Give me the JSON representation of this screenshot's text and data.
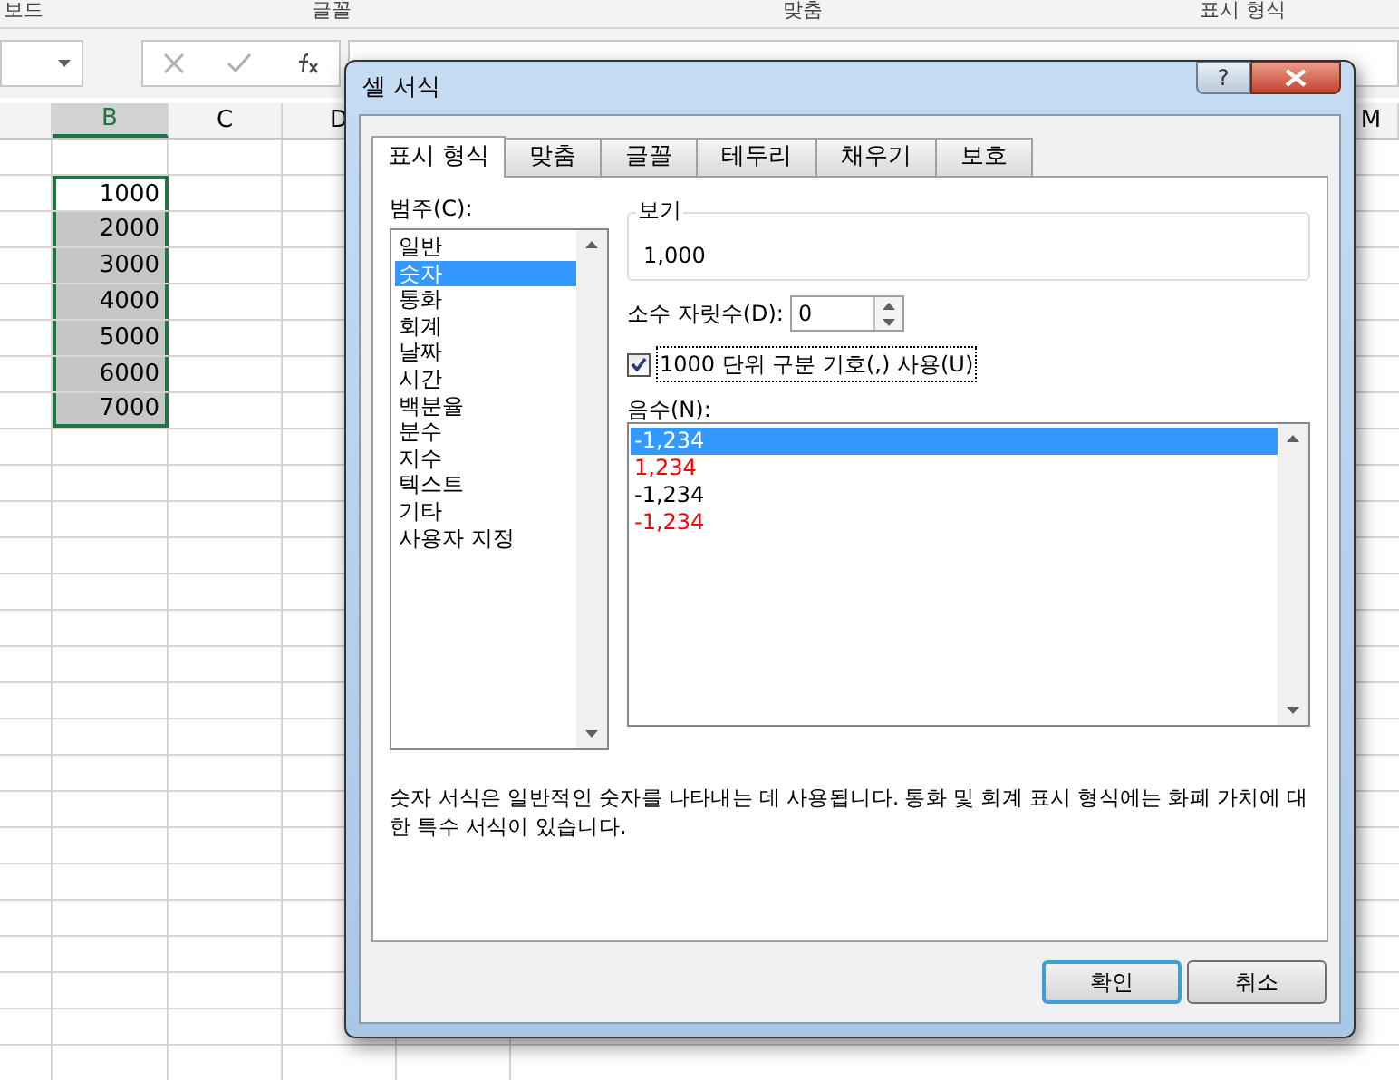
{
  "ribbon_groups": [
    "보드",
    "글꼴",
    "맞춤",
    "표시 형식"
  ],
  "columns": [
    {
      "label": "B",
      "selected": true
    },
    {
      "label": "C",
      "selected": false
    },
    {
      "label": "D",
      "selected": false
    },
    {
      "label": "M",
      "selected": false
    }
  ],
  "cells": [
    {
      "value": "1000",
      "active": true
    },
    {
      "value": "2000",
      "active": false
    },
    {
      "value": "3000",
      "active": false
    },
    {
      "value": "4000",
      "active": false
    },
    {
      "value": "5000",
      "active": false
    },
    {
      "value": "6000",
      "active": false
    },
    {
      "value": "7000",
      "active": false
    }
  ],
  "dialog": {
    "title": "셀 서식",
    "help_button": "?",
    "tabs": [
      {
        "label": "표시 형식",
        "selected": true
      },
      {
        "label": "맞춤",
        "selected": false
      },
      {
        "label": "글꼴",
        "selected": false
      },
      {
        "label": "테두리",
        "selected": false
      },
      {
        "label": "채우기",
        "selected": false
      },
      {
        "label": "보호",
        "selected": false
      }
    ],
    "category_label": "범주(C):",
    "categories": [
      {
        "label": "일반",
        "selected": false
      },
      {
        "label": "숫자",
        "selected": true
      },
      {
        "label": "통화",
        "selected": false
      },
      {
        "label": "회계",
        "selected": false
      },
      {
        "label": "날짜",
        "selected": false
      },
      {
        "label": "시간",
        "selected": false
      },
      {
        "label": "백분율",
        "selected": false
      },
      {
        "label": "분수",
        "selected": false
      },
      {
        "label": "지수",
        "selected": false
      },
      {
        "label": "텍스트",
        "selected": false
      },
      {
        "label": "기타",
        "selected": false
      },
      {
        "label": "사용자 지정",
        "selected": false
      }
    ],
    "preview": {
      "label": "보기",
      "value": "1,000"
    },
    "decimal_places": {
      "label": "소수 자릿수(D):",
      "value": "0"
    },
    "thousands_separator": {
      "label": "1000 단위 구분 기호(,) 사용(U)",
      "checked": true
    },
    "negative_numbers": {
      "label": "음수(N):",
      "options": [
        {
          "text": "-1,234",
          "selected": true
        },
        {
          "text": "1,234",
          "color": "#ff0000",
          "selected": false
        },
        {
          "text": "-1,234",
          "color": "#000000",
          "selected": false
        },
        {
          "text": "-1,234",
          "color": "#ff0000",
          "selected": false
        }
      ]
    },
    "description": "숫자 서식은 일반적인 숫자를 나타내는 데 사용됩니다. 통화 및 회계 표시 형식에는 화폐 가치에 대한 특수 서식이 있습니다.",
    "buttons": [
      {
        "label": "확인",
        "default": true
      },
      {
        "label": "취소",
        "default": false
      }
    ]
  }
}
